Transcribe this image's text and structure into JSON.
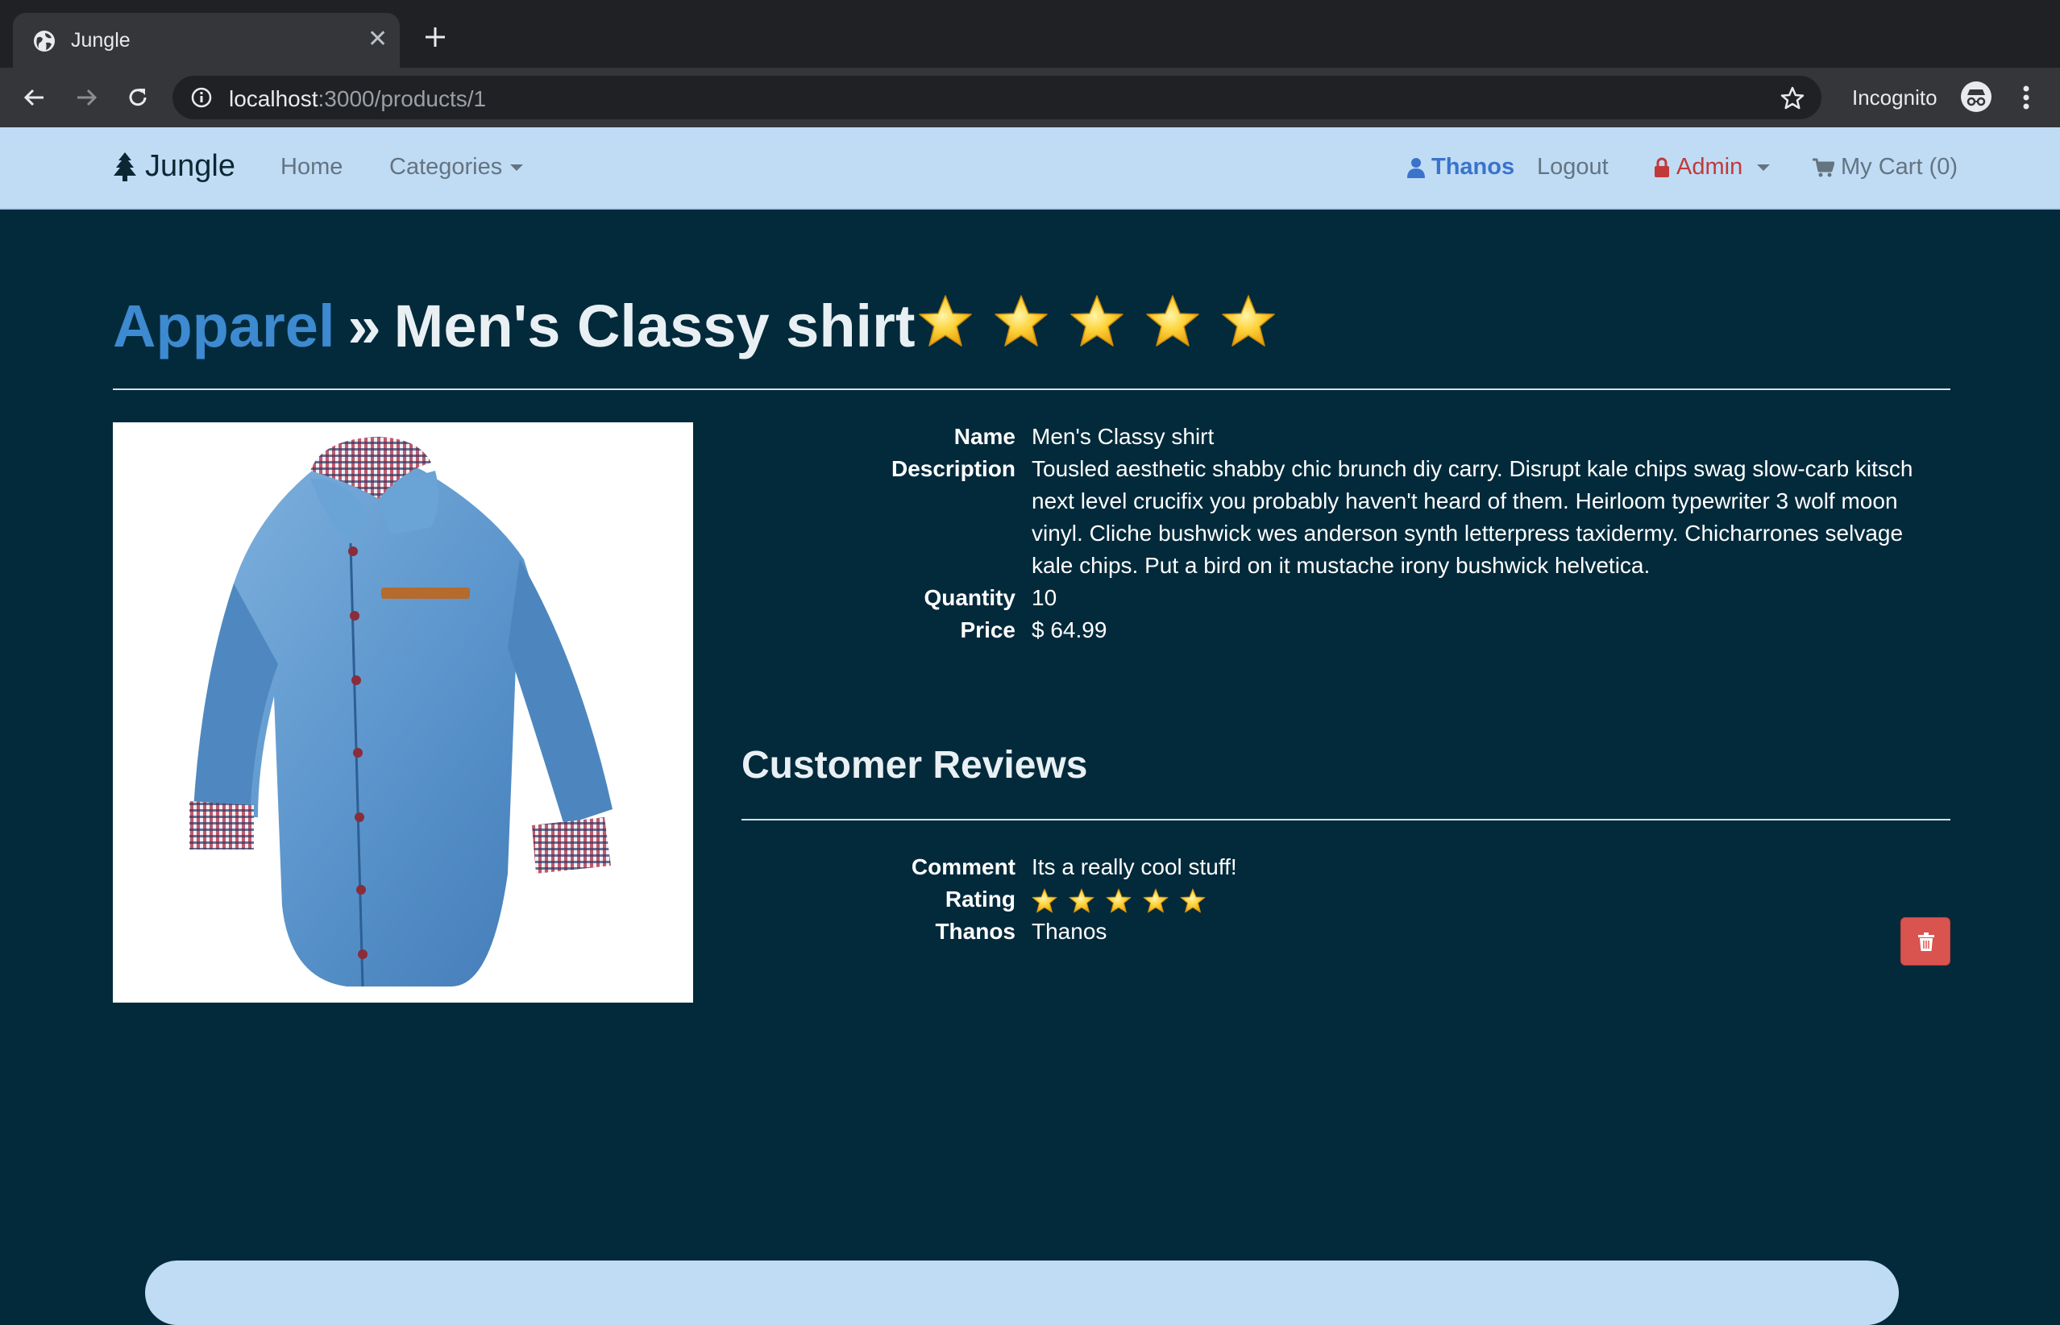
{
  "browser": {
    "tab_title": "Jungle",
    "url_host": "localhost",
    "url_path": ":3000/products/1",
    "incognito_label": "Incognito"
  },
  "navbar": {
    "brand": "Jungle",
    "home": "Home",
    "categories": "Categories",
    "user": "Thanos",
    "logout": "Logout",
    "admin": "Admin",
    "cart": "My Cart (0)"
  },
  "product": {
    "category": "Apparel",
    "separator": "»",
    "name": "Men's Classy shirt",
    "rating": 5,
    "rating_max": 5,
    "labels": {
      "name": "Name",
      "description": "Description",
      "quantity": "Quantity",
      "price": "Price"
    },
    "description": "Tousled aesthetic shabby chic brunch diy carry. Disrupt kale chips swag slow-carb kitsch next level crucifix you probably haven't heard of them. Heirloom typewriter 3 wolf moon vinyl. Cliche bushwick wes anderson synth letterpress taxidermy. Chicharrones selvage kale chips. Put a bird on it mustache irony bushwick helvetica.",
    "quantity": "10",
    "price": "$ 64.99"
  },
  "reviews": {
    "title": "Customer Reviews",
    "labels": {
      "comment": "Comment",
      "rating": "Rating",
      "reviewer": "Thanos"
    },
    "items": [
      {
        "comment": "Its a really cool stuff!",
        "rating": 5,
        "reviewer": "Thanos"
      }
    ]
  },
  "colors": {
    "page_bg": "#032a3b",
    "navbar_bg": "#c0dcf5",
    "link_blue": "#3d8ad0",
    "admin_red": "#c13a3a",
    "delete_red": "#d9534f",
    "star_gold": "#f8c12c"
  },
  "icons": {
    "tree": "tree-icon",
    "user": "user-icon",
    "lock": "lock-icon",
    "cart": "shopping-cart-icon",
    "star": "star-icon",
    "trash": "trash-icon"
  }
}
